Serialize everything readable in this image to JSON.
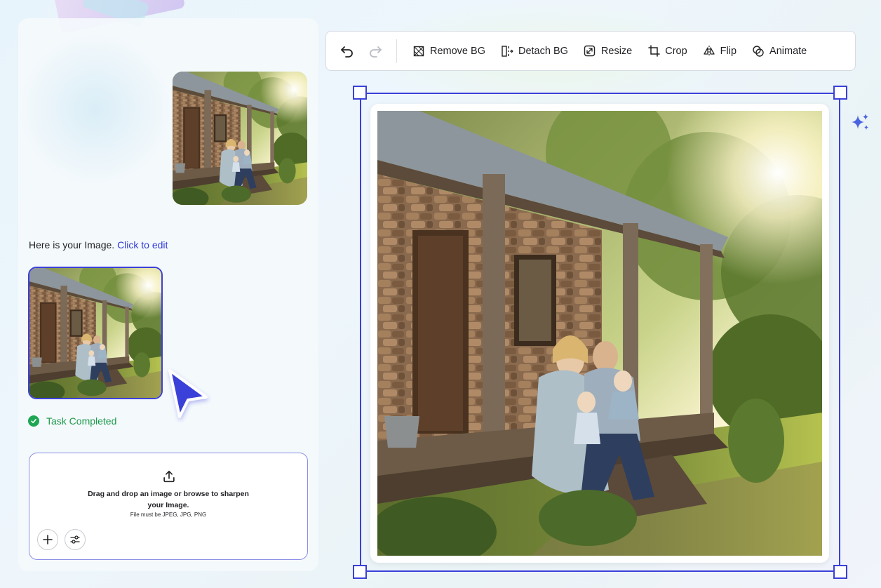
{
  "chat": {
    "message": "Here is your Image.",
    "link": "Click to edit",
    "status": "Task Completed"
  },
  "upload": {
    "line1": "Drag and drop an image or browse to sharpen your Image.",
    "sub": "File must be JPEG, JPG, PNG"
  },
  "toolbar": {
    "remove_bg": "Remove BG",
    "detach_bg": "Detach BG",
    "resize": "Resize",
    "crop": "Crop",
    "flip": "Flip",
    "animate": "Animate"
  },
  "colors": {
    "accent": "#3b40d9",
    "success": "#1ea653"
  }
}
